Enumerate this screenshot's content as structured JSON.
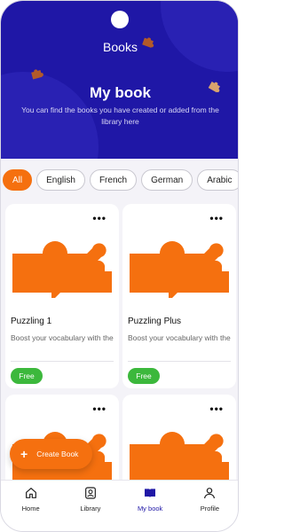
{
  "header": {
    "title": "Books",
    "heading": "My book",
    "subtitle": "You can find the books you have created or added from the library here"
  },
  "filters": {
    "chips": [
      {
        "label": "All",
        "active": true
      },
      {
        "label": "English",
        "active": false
      },
      {
        "label": "French",
        "active": false
      },
      {
        "label": "German",
        "active": false
      },
      {
        "label": "Arabic",
        "active": false
      }
    ]
  },
  "books": [
    {
      "title": "Puzzling 1",
      "description": "Boost your vocabulary with the most common English words",
      "badge": "Free",
      "more": "•••"
    },
    {
      "title": "Puzzling Plus",
      "description": "Boost your vocabulary with the most common English words",
      "badge": "Free",
      "more": "•••"
    },
    {
      "title": "",
      "description": "",
      "badge": "",
      "more": "•••"
    },
    {
      "title": "",
      "description": "",
      "badge": "",
      "more": "•••"
    }
  ],
  "fab": {
    "plus": "+",
    "label": "Create Book"
  },
  "nav": {
    "items": [
      {
        "label": "Home",
        "icon": "home-icon",
        "active": false
      },
      {
        "label": "Library",
        "icon": "library-icon",
        "active": false
      },
      {
        "label": "My book",
        "icon": "book-icon",
        "active": true
      },
      {
        "label": "Profile",
        "icon": "profile-icon",
        "active": false
      }
    ]
  },
  "colors": {
    "primary": "#1f17a6",
    "accent": "#f5700f",
    "success": "#3cb83c"
  }
}
